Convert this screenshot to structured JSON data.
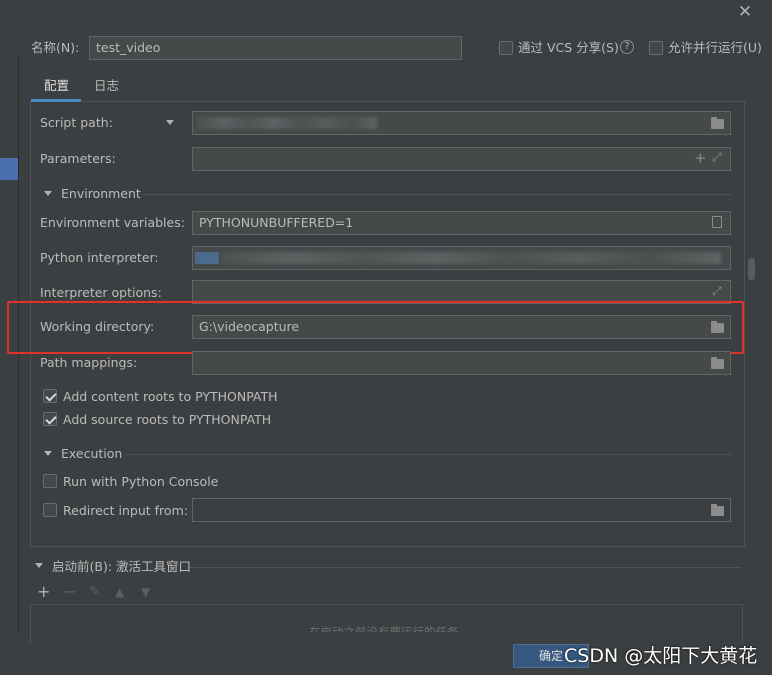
{
  "header": {
    "name_label": "名称(N)",
    "name_value": "test_video",
    "vcs_share_label": "通过 VCS 分享(S)",
    "parallel_label": "允许并行运行(U)",
    "help_icon": "help-icon",
    "close_icon": "close-icon"
  },
  "tabs": [
    {
      "label": "配置",
      "selected": true
    },
    {
      "label": "日志",
      "selected": false
    }
  ],
  "config": {
    "script_path_label": "Script path:",
    "parameters_label": "Parameters:",
    "environment_section": "Environment",
    "env_vars_label": "Environment variables:",
    "env_vars_value": "PYTHONUNBUFFERED=1",
    "interpreter_label": "Python interpreter:",
    "interpreter_options_label": "Interpreter options:",
    "working_dir_label": "Working directory:",
    "working_dir_value": "G:\\videocapture",
    "path_mappings_label": "Path mappings:",
    "add_content_roots_label": "Add content roots to PYTHONPATH",
    "add_content_roots_checked": true,
    "add_source_roots_label": "Add source roots to PYTHONPATH",
    "add_source_roots_checked": true,
    "execution_section": "Execution",
    "run_console_label": "Run with Python Console",
    "run_console_checked": false,
    "redirect_input_label": "Redirect input from:",
    "redirect_input_checked": false
  },
  "before_launch": {
    "title": "启动前(B): 激活工具窗口",
    "toolbar_icons": [
      "plus-icon",
      "minus-icon",
      "edit-icon",
      "up-icon",
      "down-icon"
    ],
    "empty_text": "在启动之前没有要运行的任务"
  },
  "footer": {
    "ok_label": "确定"
  },
  "watermark": "CSDN @太阳下大黄花",
  "colors": {
    "background": "#3c3f41",
    "field_bg": "#45494a",
    "accent": "#4a88c7",
    "highlight_border": "#e03328",
    "ok_button": "#365880"
  }
}
